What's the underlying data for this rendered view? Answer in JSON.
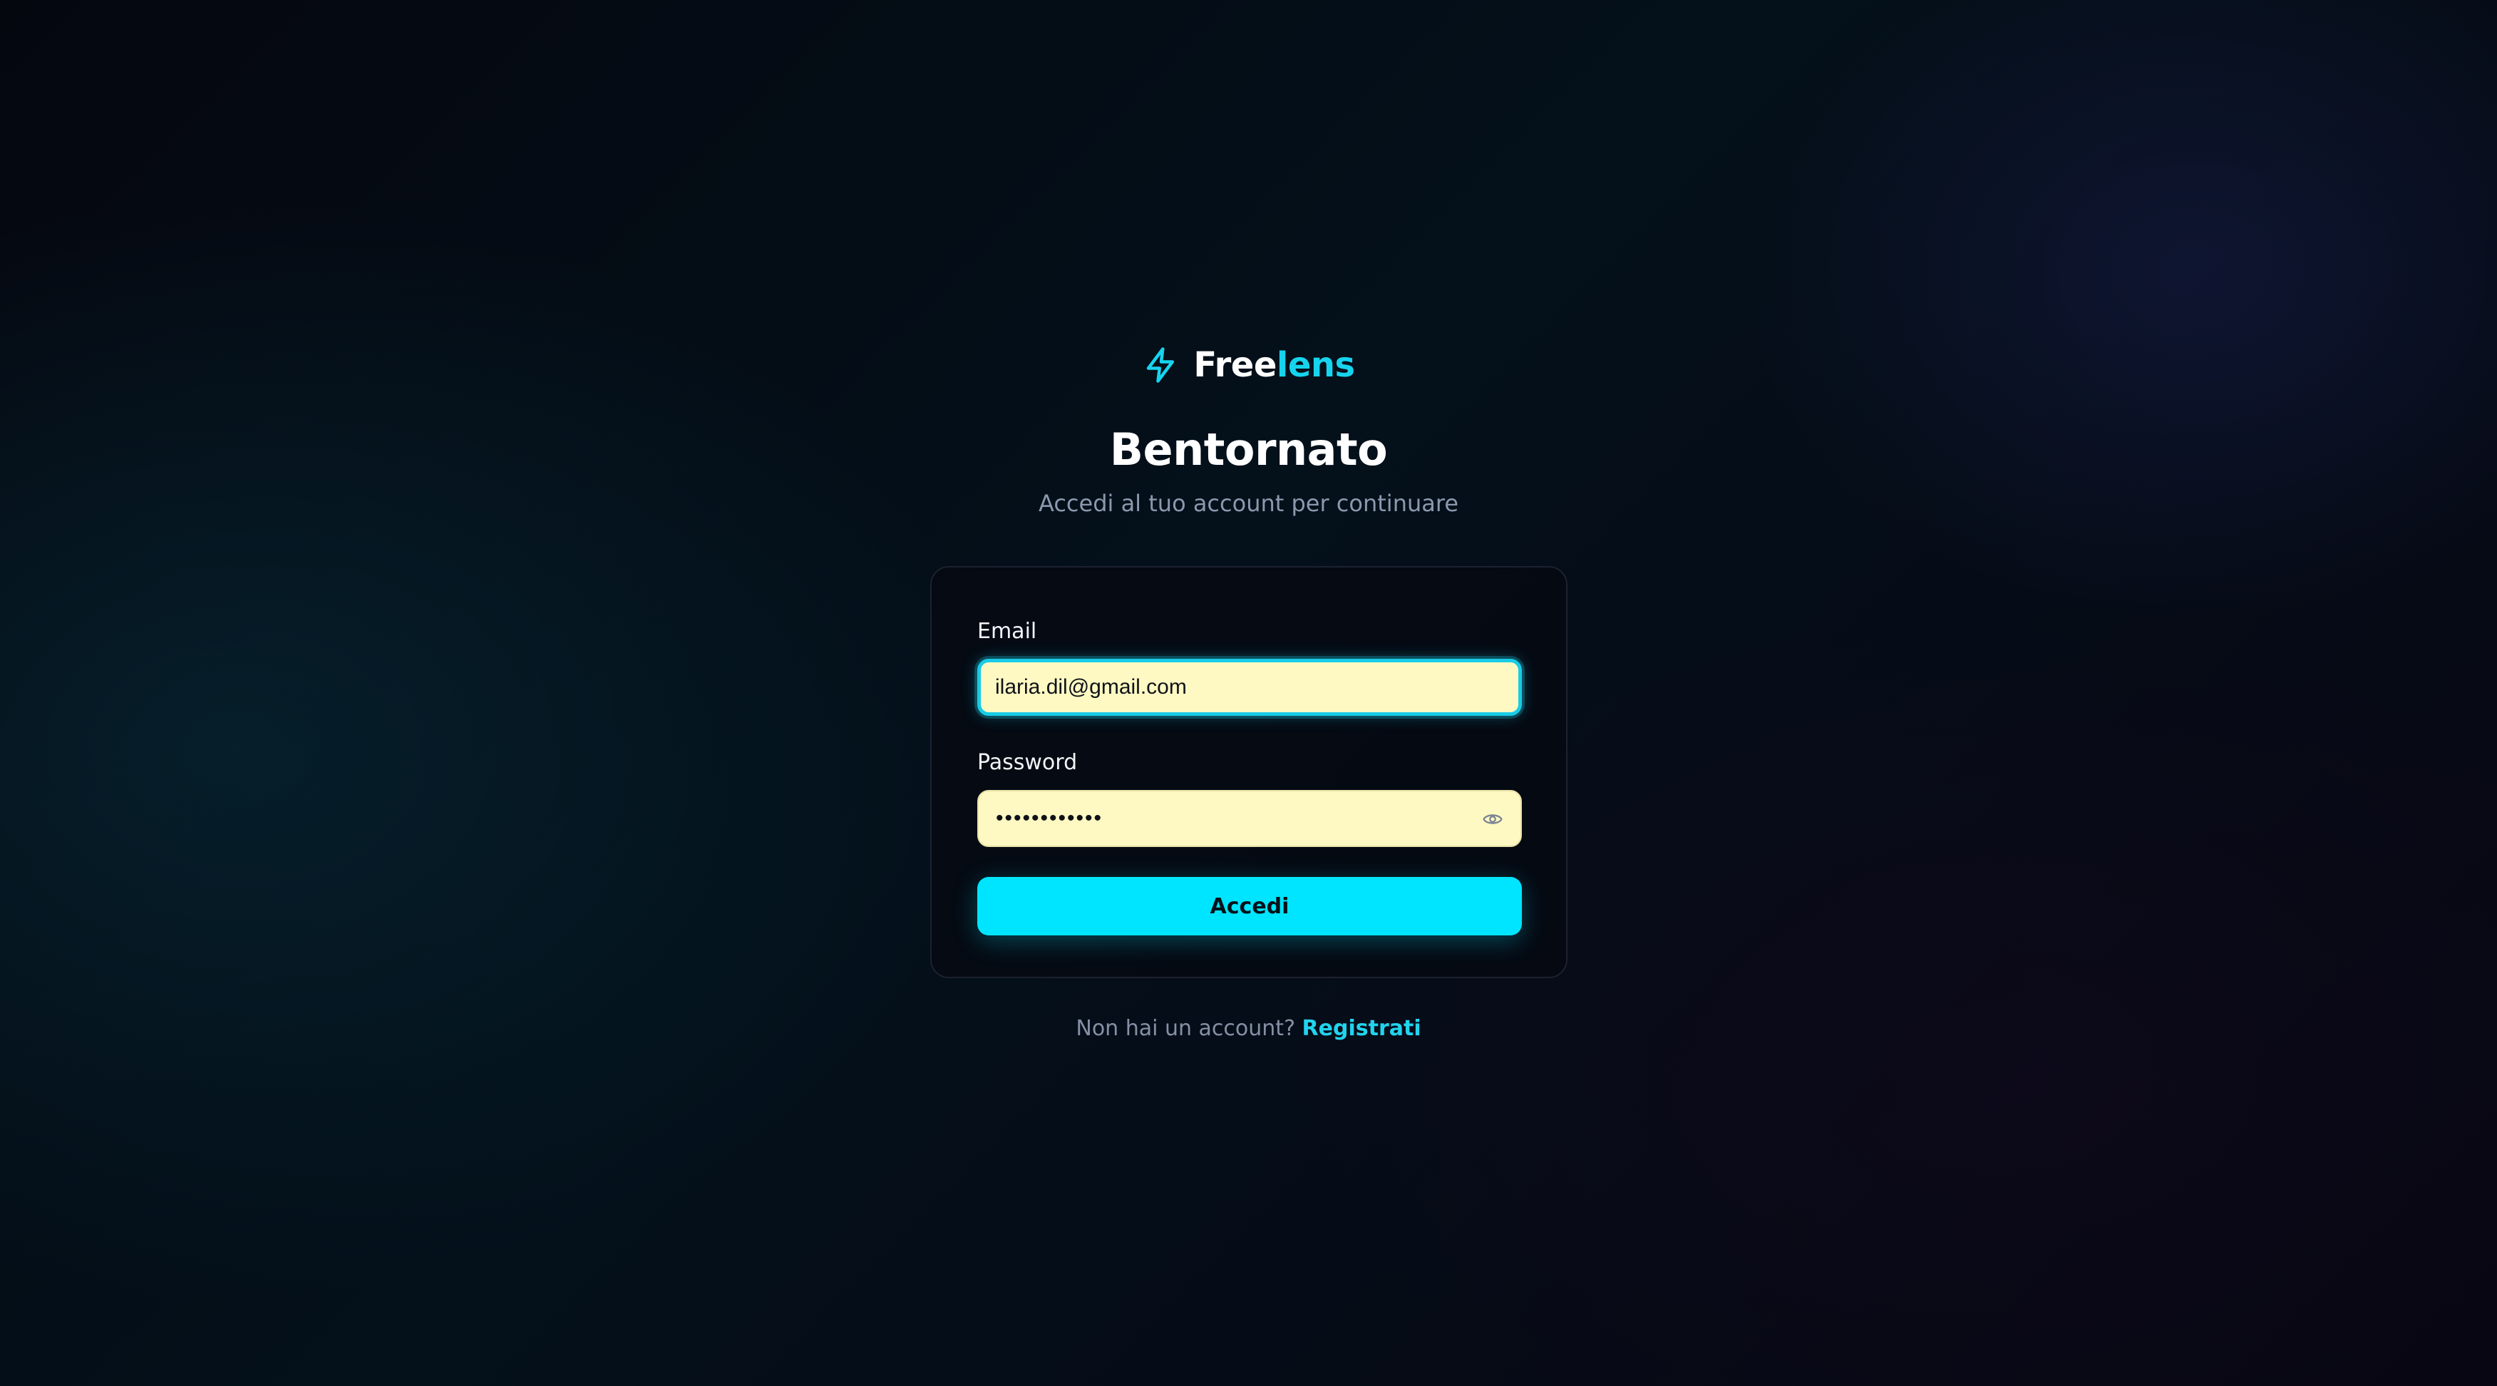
{
  "brand": {
    "name_part1": "Free",
    "name_part2": "lens",
    "icon": "lightning-bolt-icon",
    "accent_color": "#16d4ee"
  },
  "header": {
    "title": "Bentornato",
    "subtitle": "Accedi al tuo account per continuare"
  },
  "form": {
    "email": {
      "label": "Email",
      "value": "ilaria.dil@gmail.com",
      "focused": true
    },
    "password": {
      "label": "Password",
      "value": "••••••••••••",
      "toggle_icon": "eye-icon"
    },
    "submit_label": "Accedi",
    "submit_color": "#00e5ff",
    "autofill_color": "#fef9c3"
  },
  "footer": {
    "prompt": "Non hai un account?",
    "link_label": "Registrati"
  }
}
